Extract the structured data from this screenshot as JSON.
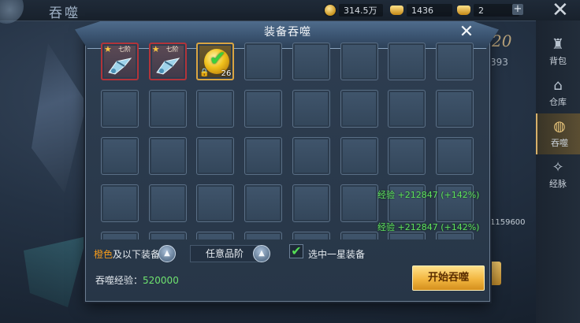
{
  "colors": {
    "accent_gold": "#f2b640",
    "exp_green": "#5fe25f",
    "quality_orange": "#f39a1b",
    "red_frame": "#b2343a"
  },
  "background": {
    "title": "吞噬",
    "resources": [
      {
        "icon": "coin-icon",
        "value": "314.5万"
      },
      {
        "icon": "ingot-icon",
        "value": "1436"
      },
      {
        "icon": "ingot-icon",
        "value": "2"
      }
    ],
    "plus_icon": "+",
    "close_icon": "✕",
    "side_nav": [
      {
        "icon": "bag-icon",
        "label": "背包"
      },
      {
        "icon": "warehouse-icon",
        "label": "仓库"
      },
      {
        "icon": "devour-icon",
        "label": "吞噬",
        "active": true
      },
      {
        "icon": "meridian-icon",
        "label": "经脉"
      }
    ],
    "numbers": {
      "level_num": "20",
      "partial_num": "393",
      "exp_total": "1159600"
    }
  },
  "dialog": {
    "title": "装备吞噬",
    "close_icon": "✕",
    "slots": [
      {
        "type": "weapon",
        "frame": "red",
        "star": "★",
        "tier": "七阶"
      },
      {
        "type": "weapon",
        "frame": "red",
        "star": "★",
        "tier": "七阶"
      },
      {
        "type": "gem",
        "frame": "gold",
        "count": "26",
        "selected": true,
        "locked": true
      }
    ],
    "exp_lines": [
      "经验 +212847 (+142%)",
      "经验 +212847 (+142%)"
    ],
    "filters": {
      "quality_color": "橙色",
      "quality_suffix": "及以下装备",
      "tier_label": "任意品阶",
      "drop_icon": "▲",
      "checkbox_label": "选中一星装备",
      "checkbox_checked": true
    },
    "devour_exp_label": "吞噬经验：",
    "devour_exp_value": "520000",
    "start_button": "开始吞噬"
  }
}
